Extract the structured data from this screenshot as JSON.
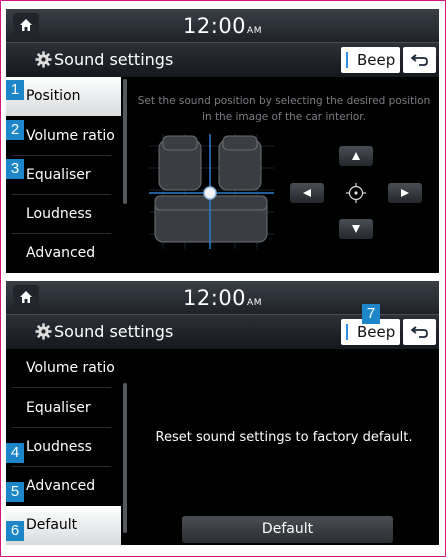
{
  "colors": {
    "accent": "#1c86c8",
    "frame": "#d0167a",
    "beep_bar": "#2a8ee0"
  },
  "status": {
    "time": "12:00",
    "ampm": "AM"
  },
  "header": {
    "title": "Sound settings",
    "beep_label": "Beep"
  },
  "screen1": {
    "menu": [
      "Position",
      "Volume ratio",
      "Equaliser",
      "Loudness",
      "Advanced"
    ],
    "selected": "Position",
    "instructions": "Set the sound position by selecting the desired position in the image of the car interior."
  },
  "screen2": {
    "menu": [
      "Volume ratio",
      "Equaliser",
      "Loudness",
      "Advanced",
      "Default"
    ],
    "selected": "Default",
    "reset_text": "Reset sound settings to factory default.",
    "default_button": "Default"
  },
  "markers": [
    "1",
    "2",
    "3",
    "4",
    "5",
    "6",
    "7"
  ]
}
